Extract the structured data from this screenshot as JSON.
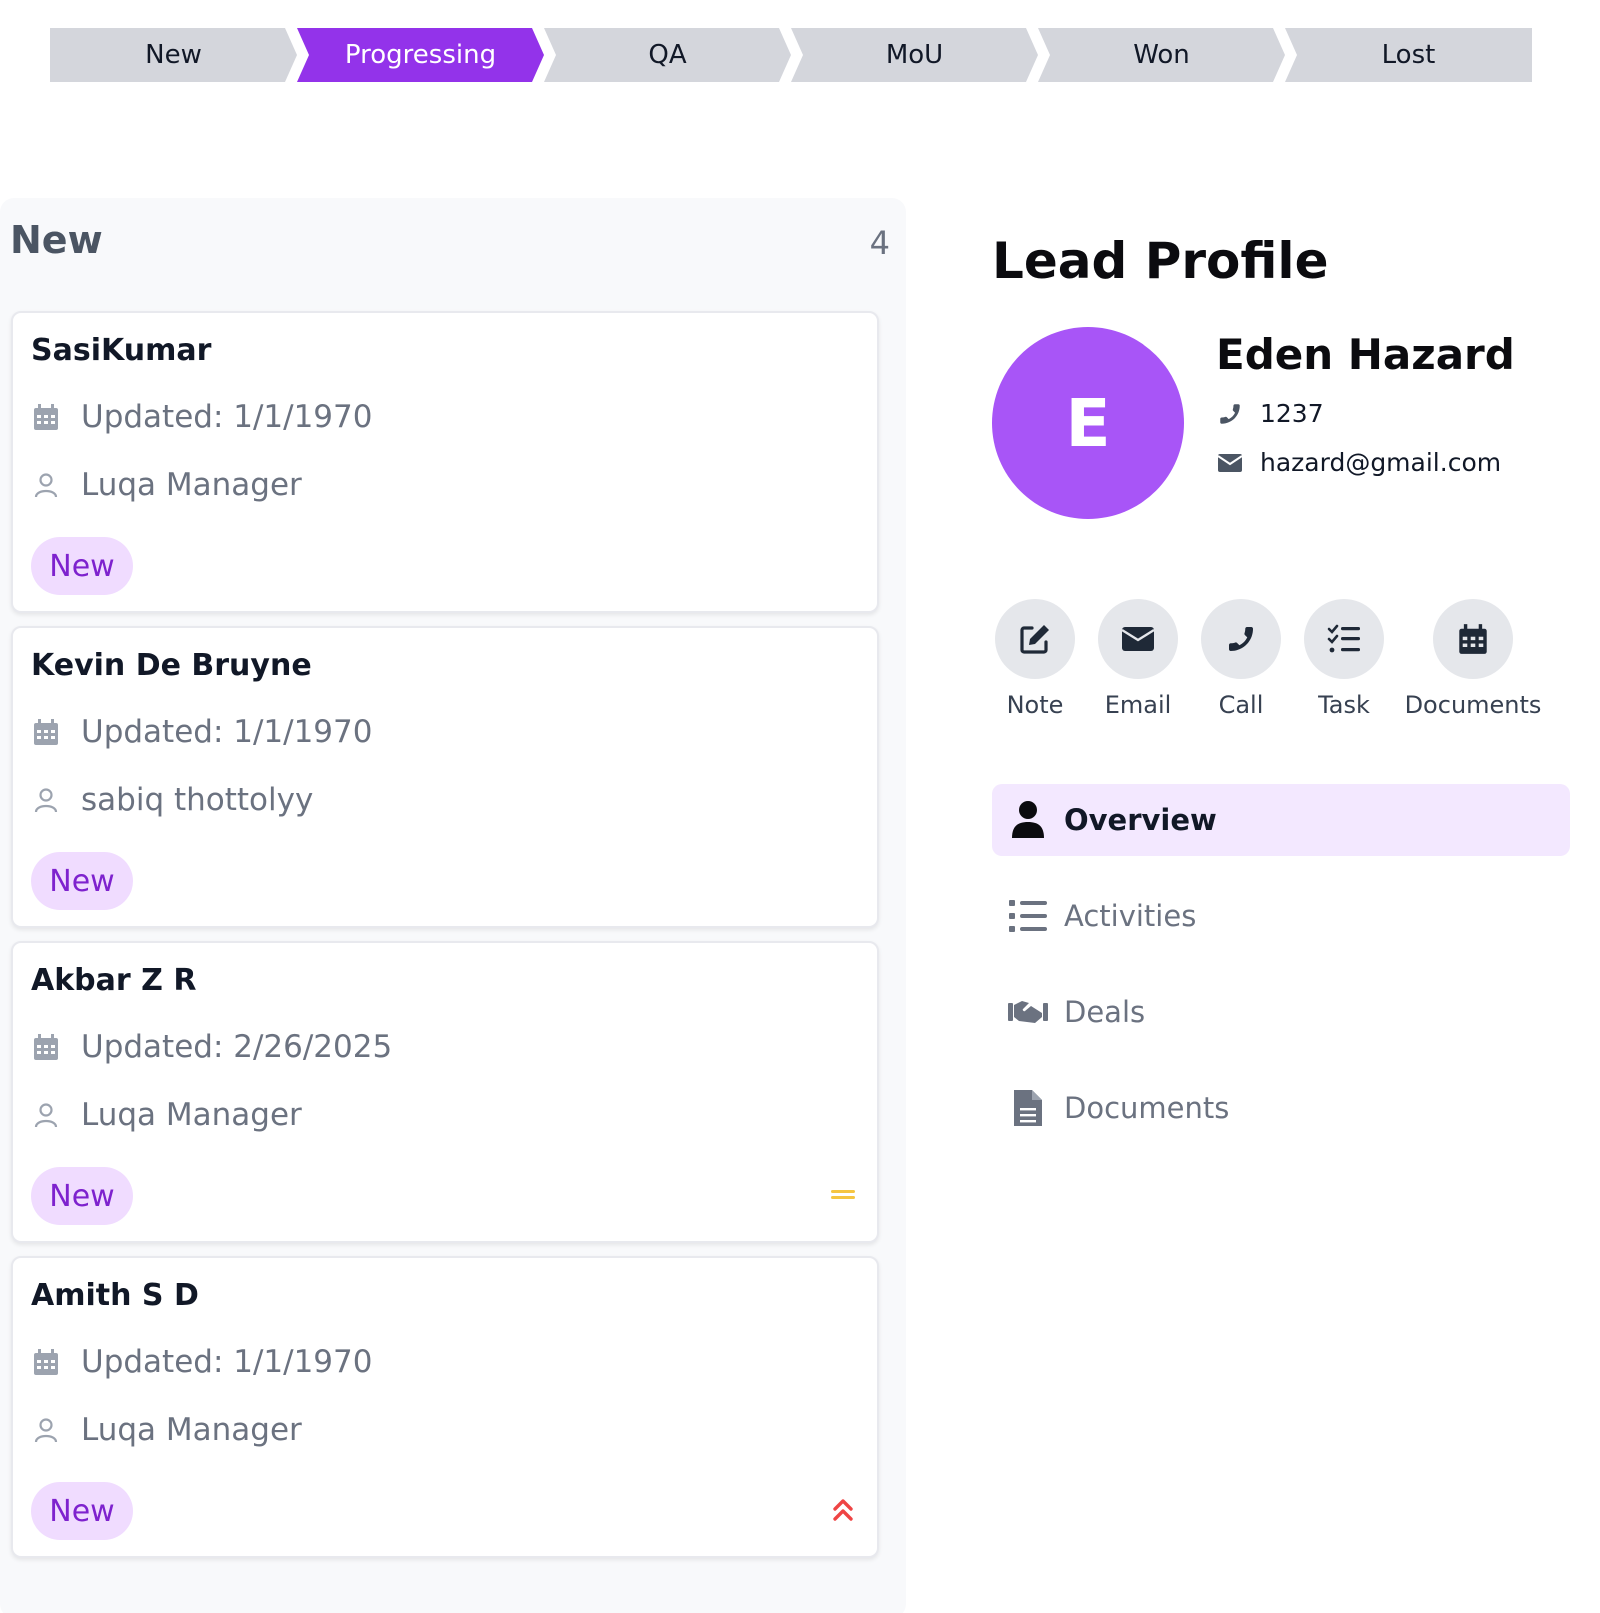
{
  "pipeline": {
    "stages": [
      "New",
      "Progressing",
      "QA",
      "MoU",
      "Won",
      "Lost"
    ],
    "active": "Progressing"
  },
  "column": {
    "title": "New",
    "count": "4",
    "cards": [
      {
        "name": "SasiKumar",
        "updated": "Updated: 1/1/1970",
        "owner": "Luqa Manager",
        "badge": "New",
        "priority_icon": ""
      },
      {
        "name": "Kevin De Bruyne",
        "updated": "Updated: 1/1/1970",
        "owner": "sabiq thottolyy",
        "badge": "New",
        "priority_icon": ""
      },
      {
        "name": "Akbar Z R",
        "updated": "Updated: 2/26/2025",
        "owner": "Luqa Manager",
        "badge": "New",
        "priority_icon": "medium-priority-icon"
      },
      {
        "name": "Amith S D",
        "updated": "Updated: 1/1/1970",
        "owner": "Luqa Manager",
        "badge": "New",
        "priority_icon": "high-priority-icon"
      }
    ]
  },
  "profile": {
    "title": "Lead Profile",
    "avatar_initial": "E",
    "name": "Eden Hazard",
    "phone": "1237",
    "email": "hazard@gmail.com"
  },
  "actions": [
    "Note",
    "Email",
    "Call",
    "Task",
    "Documents"
  ],
  "nav": {
    "items": [
      "Overview",
      "Activities",
      "Deals",
      "Documents"
    ],
    "active": "Overview"
  },
  "colors": {
    "accent": "#9333ea",
    "avatar": "#a855f7",
    "badge_bg": "#f0dcff",
    "badge_text": "#7e22ce",
    "priority_medium": "#f5c542",
    "priority_high": "#ef4444"
  }
}
